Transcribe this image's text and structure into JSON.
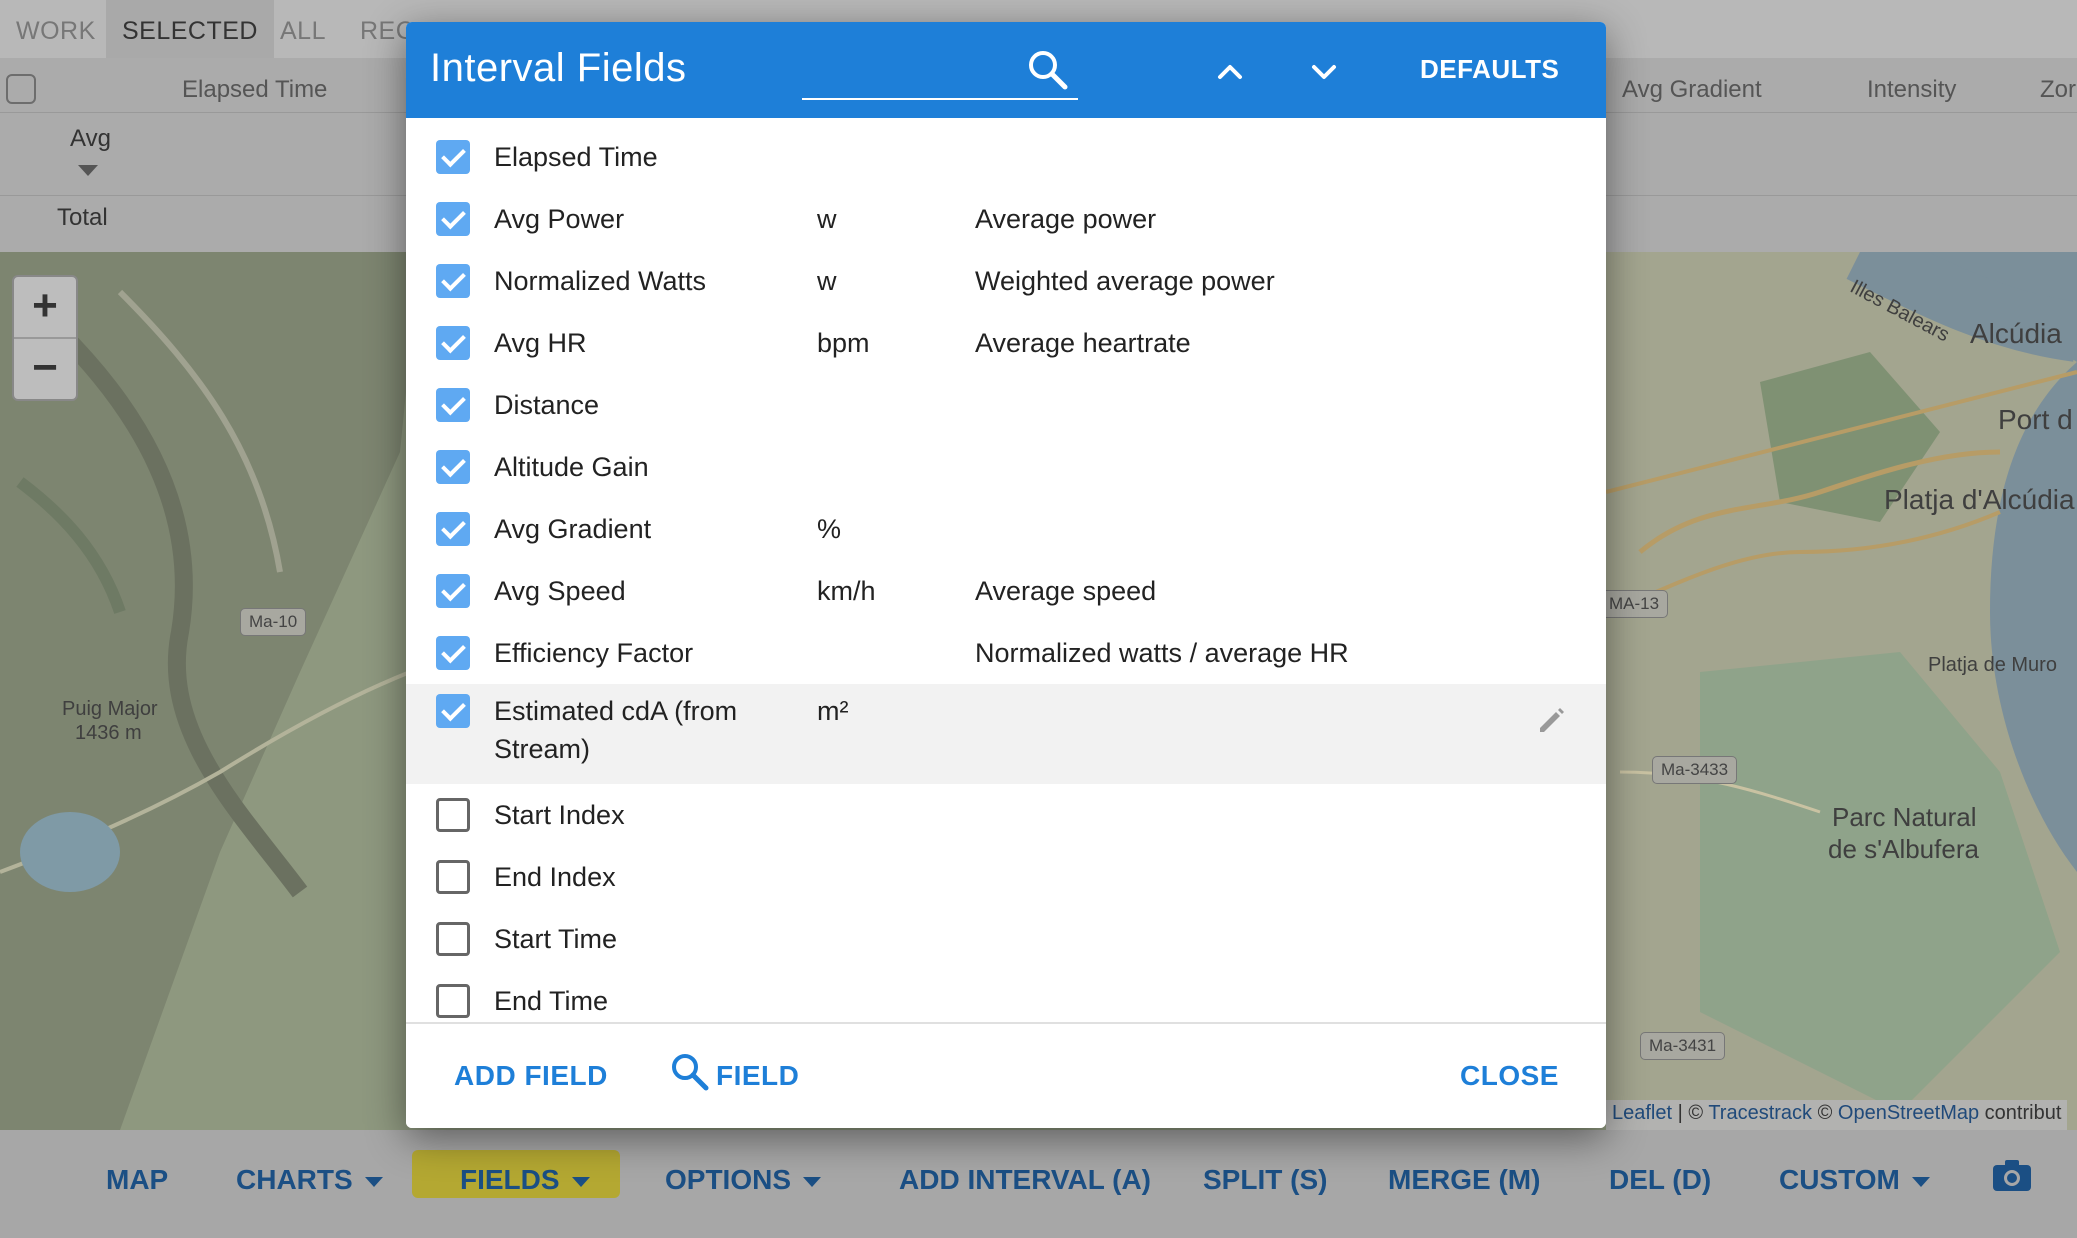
{
  "top_tabs": [
    "WORK",
    "SELECTED",
    "ALL",
    "REC"
  ],
  "table_header": {
    "elapsed_time": "Elapsed Time",
    "avg_gradient": "Avg Gradient",
    "intensity": "Intensity",
    "zones": "Zor"
  },
  "summary_rows": {
    "avg": "Avg",
    "total": "Total"
  },
  "map": {
    "zoom_in": "+",
    "zoom_out": "−",
    "labels": {
      "puig_major": "Puig Major",
      "puig_elev": "1436 m",
      "illes": "Illes Balears",
      "alcudia": "Alcúdia",
      "port": "Port d",
      "platja": "Platja d'Alcúdia",
      "platja_muro": "Platja de Muro",
      "parc1": "Parc Natural",
      "parc2": "de s'Albufera"
    },
    "roads": {
      "ma10": "Ma-10",
      "ma13": "MA-13",
      "ma3433": "Ma-3433",
      "ma3431": "Ma-3431"
    },
    "attribution": {
      "leaflet": "Leaflet",
      "sep": " | © ",
      "tracestrack": "Tracestrack",
      "copy": " © ",
      "osm": "OpenStreetMap",
      "tail": " contribut"
    }
  },
  "bottom_bar": {
    "map": "MAP",
    "charts": "CHARTS",
    "fields": "FIELDS",
    "options": "OPTIONS",
    "add_interval": "ADD INTERVAL (A)",
    "split": "SPLIT (S)",
    "merge": "MERGE (M)",
    "del": "DEL (D)",
    "custom": "CUSTOM",
    "camera_icon": "camera-icon"
  },
  "dialog": {
    "title": "Interval Fields",
    "search_placeholder": "",
    "defaults_label": "DEFAULTS",
    "fields": [
      {
        "name": "Elapsed Time",
        "unit": "",
        "description": "",
        "checked": true
      },
      {
        "name": "Avg Power",
        "unit": "w",
        "description": "Average power",
        "checked": true
      },
      {
        "name": "Normalized Watts",
        "unit": "w",
        "description": "Weighted average power",
        "checked": true
      },
      {
        "name": "Avg HR",
        "unit": "bpm",
        "description": "Average heartrate",
        "checked": true
      },
      {
        "name": "Distance",
        "unit": "",
        "description": "",
        "checked": true
      },
      {
        "name": "Altitude Gain",
        "unit": "",
        "description": "",
        "checked": true
      },
      {
        "name": "Avg Gradient",
        "unit": "%",
        "description": "",
        "checked": true
      },
      {
        "name": "Avg Speed",
        "unit": "km/h",
        "description": "Average speed",
        "checked": true
      },
      {
        "name": "Efficiency Factor",
        "unit": "",
        "description": "Normalized watts / average HR",
        "checked": true
      },
      {
        "name": "Estimated cdA (from Stream)",
        "unit": "m²",
        "description": "",
        "checked": true
      },
      {
        "name": "Start Index",
        "unit": "",
        "description": "",
        "checked": false
      },
      {
        "name": "End Index",
        "unit": "",
        "description": "",
        "checked": false
      },
      {
        "name": "Start Time",
        "unit": "",
        "description": "",
        "checked": false
      },
      {
        "name": "End Time",
        "unit": "",
        "description": "",
        "checked": false
      }
    ],
    "footer": {
      "add_field": "ADD FIELD",
      "search_field": "FIELD",
      "close": "CLOSE"
    }
  },
  "colors": {
    "header_blue": "#1e7fd8",
    "checkbox_blue": "#5fa9f2",
    "bar_text": "#1b4f84",
    "fields_highlight": "#f5e63a"
  }
}
